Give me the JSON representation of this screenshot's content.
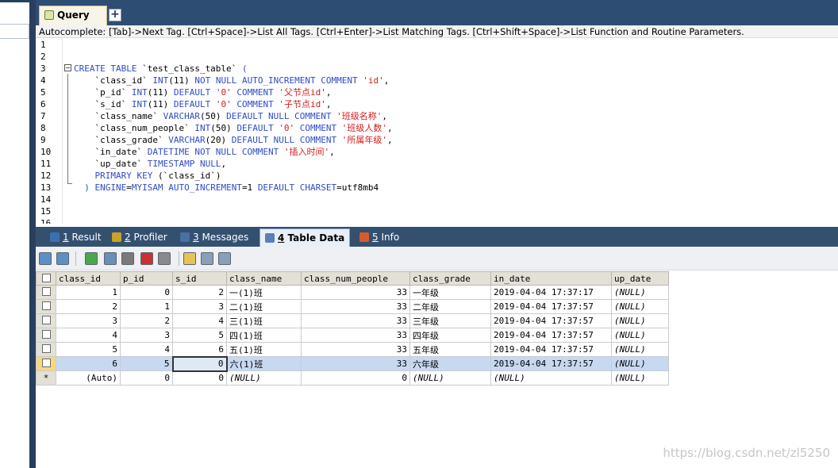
{
  "tabs": {
    "query_label": "Query",
    "add_label": "+"
  },
  "autocomplete_text": "Autocomplete: [Tab]->Next Tag. [Ctrl+Space]->List All Tags. [Ctrl+Enter]->List Matching Tags. [Ctrl+Shift+Space]->List Function and Routine Parameters.",
  "editor": {
    "line_numbers": [
      "1",
      "2",
      "3",
      "4",
      "5",
      "6",
      "7",
      "8",
      "9",
      "10",
      "11",
      "12",
      "13",
      "14",
      "15",
      "16"
    ],
    "lines": [
      [],
      [],
      [
        [
          "kw",
          "CREATE TABLE "
        ],
        [
          "",
          "`test_class_table` "
        ],
        [
          "kw",
          "("
        ]
      ],
      [
        [
          "",
          "    `class_id` "
        ],
        [
          "kw",
          "INT"
        ],
        [
          "",
          "(11) "
        ],
        [
          "kw",
          "NOT NULL AUTO_INCREMENT COMMENT "
        ],
        [
          "str",
          "'id'"
        ],
        [
          "",
          ","
        ]
      ],
      [
        [
          "",
          "    `p_id` "
        ],
        [
          "kw",
          "INT"
        ],
        [
          "",
          "(11) "
        ],
        [
          "kw",
          "DEFAULT "
        ],
        [
          "str",
          "'0'"
        ],
        [
          "kw",
          " COMMENT "
        ],
        [
          "str",
          "'父节点id'"
        ],
        [
          "",
          ","
        ]
      ],
      [
        [
          "",
          "    `s_id` "
        ],
        [
          "kw",
          "INT"
        ],
        [
          "",
          "(11) "
        ],
        [
          "kw",
          "DEFAULT "
        ],
        [
          "str",
          "'0'"
        ],
        [
          "kw",
          " COMMENT "
        ],
        [
          "str",
          "'子节点id'"
        ],
        [
          "",
          ","
        ]
      ],
      [
        [
          "",
          "    `class_name` "
        ],
        [
          "kw",
          "VARCHAR"
        ],
        [
          "",
          "(50) "
        ],
        [
          "kw",
          "DEFAULT NULL COMMENT "
        ],
        [
          "str",
          "'班级名称'"
        ],
        [
          "",
          ","
        ]
      ],
      [
        [
          "",
          "    `class_num_people` "
        ],
        [
          "kw",
          "INT"
        ],
        [
          "",
          "(50) "
        ],
        [
          "kw",
          "DEFAULT "
        ],
        [
          "str",
          "'0'"
        ],
        [
          "kw",
          " COMMENT "
        ],
        [
          "str",
          "'班级人数'"
        ],
        [
          "",
          ","
        ]
      ],
      [
        [
          "",
          "    `class_grade` "
        ],
        [
          "kw",
          "VARCHAR"
        ],
        [
          "",
          "(20) "
        ],
        [
          "kw",
          "DEFAULT NULL COMMENT "
        ],
        [
          "str",
          "'所属年级'"
        ],
        [
          "",
          ","
        ]
      ],
      [
        [
          "",
          "    `in_date` "
        ],
        [
          "kw",
          "DATETIME NOT NULL COMMENT "
        ],
        [
          "str",
          "'插入时间'"
        ],
        [
          "",
          ","
        ]
      ],
      [
        [
          "",
          "    `up_date` "
        ],
        [
          "kw",
          "TIMESTAMP NULL"
        ],
        [
          "",
          ","
        ]
      ],
      [
        [
          "kw",
          "    PRIMARY KEY "
        ],
        [
          "",
          "(`class_id`)"
        ]
      ],
      [
        [
          "kw",
          "  ) ENGINE"
        ],
        [
          "",
          "="
        ],
        [
          "kw",
          "MYISAM AUTO_INCREMENT"
        ],
        [
          "",
          "=1 "
        ],
        [
          "kw",
          "DEFAULT CHARSET"
        ],
        [
          "",
          "=utf8mb4"
        ]
      ],
      [],
      [],
      []
    ]
  },
  "result_tabs": [
    {
      "num": "1",
      "label": " Result",
      "active": false,
      "color": "#3d6fb0"
    },
    {
      "num": "2",
      "label": " Profiler",
      "active": false,
      "color": "#c9a227"
    },
    {
      "num": "3",
      "label": " Messages",
      "active": false,
      "color": "#4a6fa5"
    },
    {
      "num": "4",
      "label": " Table Data",
      "active": true,
      "color": "#5b7fb8"
    },
    {
      "num": "5",
      "label": " Info",
      "active": false,
      "color": "#d85a2a"
    }
  ],
  "toolbar_icons": [
    "import-icon",
    "export-icon",
    "add-row-icon",
    "duplicate-row-icon",
    "save-icon",
    "delete-icon",
    "cancel-icon",
    "grid-view-icon",
    "form-view-icon",
    "text-view-icon"
  ],
  "table": {
    "columns": [
      "class_id",
      "p_id",
      "s_id",
      "class_name",
      "class_num_people",
      "class_grade",
      "in_date",
      "up_date"
    ],
    "rows": [
      [
        "1",
        "0",
        "2",
        "一(1)班",
        "33",
        "一年级",
        "2019-04-04 17:37:17",
        "(NULL)"
      ],
      [
        "2",
        "1",
        "3",
        "二(1)班",
        "33",
        "二年级",
        "2019-04-04 17:37:57",
        "(NULL)"
      ],
      [
        "3",
        "2",
        "4",
        "三(1)班",
        "33",
        "三年级",
        "2019-04-04 17:37:57",
        "(NULL)"
      ],
      [
        "4",
        "3",
        "5",
        "四(1)班",
        "33",
        "四年级",
        "2019-04-04 17:37:57",
        "(NULL)"
      ],
      [
        "5",
        "4",
        "6",
        "五(1)班",
        "33",
        "五年级",
        "2019-04-04 17:37:57",
        "(NULL)"
      ],
      [
        "6",
        "5",
        "0",
        "六(1)班",
        "33",
        "六年级",
        "2019-04-04 17:37:57",
        "(NULL)"
      ]
    ],
    "new_row": [
      "(Auto)",
      "0",
      "0",
      "(NULL)",
      "0",
      "(NULL)",
      "(NULL)",
      "(NULL)"
    ],
    "new_row_marker": "*",
    "selected_row_index": 5
  },
  "watermark": "https://blog.csdn.net/zl5250"
}
